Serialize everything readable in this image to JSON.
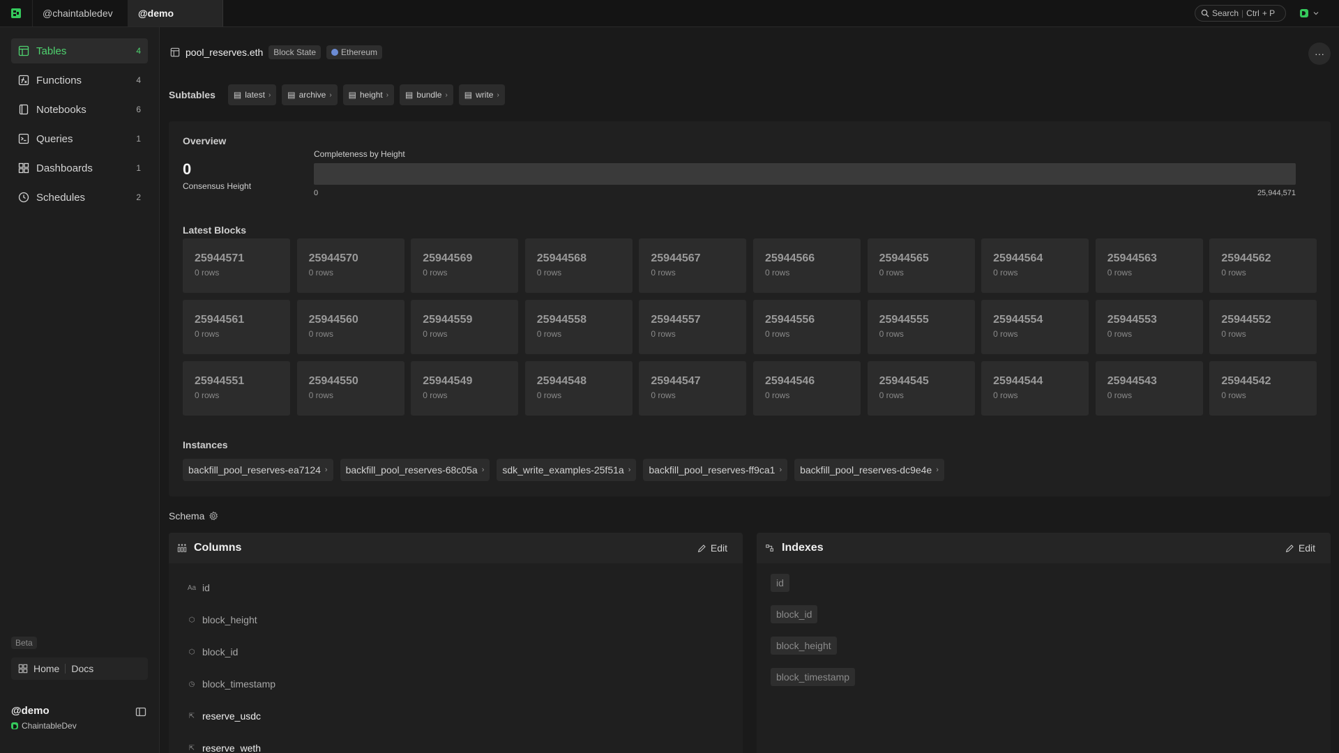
{
  "topbar": {
    "tabs": [
      {
        "label": "@chaintabledev",
        "active": false
      },
      {
        "label": "@demo",
        "active": true
      }
    ],
    "search": {
      "label": "Search",
      "key1": "Ctrl",
      "key2": "+ P"
    }
  },
  "sidebar": {
    "items": [
      {
        "label": "Tables",
        "count": "4",
        "icon": "table-icon",
        "active": true
      },
      {
        "label": "Functions",
        "count": "4",
        "icon": "function-icon",
        "active": false
      },
      {
        "label": "Notebooks",
        "count": "6",
        "icon": "notebook-icon",
        "active": false
      },
      {
        "label": "Queries",
        "count": "1",
        "icon": "terminal-icon",
        "active": false
      },
      {
        "label": "Dashboards",
        "count": "1",
        "icon": "grid-icon",
        "active": false
      },
      {
        "label": "Schedules",
        "count": "2",
        "icon": "clock-icon",
        "active": false
      }
    ],
    "beta": "Beta",
    "home_label": "Home",
    "docs_label": "Docs",
    "workspace": {
      "name": "@demo",
      "org": "ChaintableDev"
    }
  },
  "table": {
    "name": "pool_reserves.eth",
    "tag_block_state": "Block State",
    "tag_chain": "Ethereum"
  },
  "subtables": {
    "label": "Subtables",
    "items": [
      "latest",
      "archive",
      "height",
      "bundle",
      "write"
    ]
  },
  "overview": {
    "title": "Overview",
    "consensus_value": "0",
    "consensus_label": "Consensus Height",
    "completeness_label": "Completeness by Height",
    "completeness_fraction": 0,
    "range_min": "0",
    "range_max": "25,944,571"
  },
  "latest_blocks": {
    "title": "Latest Blocks",
    "blocks": [
      {
        "number": "25944571",
        "rows": "0 rows"
      },
      {
        "number": "25944570",
        "rows": "0 rows"
      },
      {
        "number": "25944569",
        "rows": "0 rows"
      },
      {
        "number": "25944568",
        "rows": "0 rows"
      },
      {
        "number": "25944567",
        "rows": "0 rows"
      },
      {
        "number": "25944566",
        "rows": "0 rows"
      },
      {
        "number": "25944565",
        "rows": "0 rows"
      },
      {
        "number": "25944564",
        "rows": "0 rows"
      },
      {
        "number": "25944563",
        "rows": "0 rows"
      },
      {
        "number": "25944562",
        "rows": "0 rows"
      },
      {
        "number": "25944561",
        "rows": "0 rows"
      },
      {
        "number": "25944560",
        "rows": "0 rows"
      },
      {
        "number": "25944559",
        "rows": "0 rows"
      },
      {
        "number": "25944558",
        "rows": "0 rows"
      },
      {
        "number": "25944557",
        "rows": "0 rows"
      },
      {
        "number": "25944556",
        "rows": "0 rows"
      },
      {
        "number": "25944555",
        "rows": "0 rows"
      },
      {
        "number": "25944554",
        "rows": "0 rows"
      },
      {
        "number": "25944553",
        "rows": "0 rows"
      },
      {
        "number": "25944552",
        "rows": "0 rows"
      },
      {
        "number": "25944551",
        "rows": "0 rows"
      },
      {
        "number": "25944550",
        "rows": "0 rows"
      },
      {
        "number": "25944549",
        "rows": "0 rows"
      },
      {
        "number": "25944548",
        "rows": "0 rows"
      },
      {
        "number": "25944547",
        "rows": "0 rows"
      },
      {
        "number": "25944546",
        "rows": "0 rows"
      },
      {
        "number": "25944545",
        "rows": "0 rows"
      },
      {
        "number": "25944544",
        "rows": "0 rows"
      },
      {
        "number": "25944543",
        "rows": "0 rows"
      },
      {
        "number": "25944542",
        "rows": "0 rows"
      }
    ]
  },
  "instances": {
    "title": "Instances",
    "items": [
      "backfill_pool_reserves-ea7124",
      "backfill_pool_reserves-68c05a",
      "sdk_write_examples-25f51a",
      "backfill_pool_reserves-ff9ca1",
      "backfill_pool_reserves-dc9e4e"
    ]
  },
  "schema": {
    "title": "Schema",
    "columns": {
      "title": "Columns",
      "edit_label": "Edit",
      "items": [
        {
          "name": "id",
          "type_icon": "text-type-icon",
          "type_glyph": "Aa",
          "emphasis": false
        },
        {
          "name": "block_height",
          "type_icon": "number-type-icon",
          "type_glyph": "⬡",
          "emphasis": false
        },
        {
          "name": "block_id",
          "type_icon": "number-type-icon",
          "type_glyph": "⬡",
          "emphasis": false
        },
        {
          "name": "block_timestamp",
          "type_icon": "clock-type-icon",
          "type_glyph": "◷",
          "emphasis": false
        },
        {
          "name": "reserve_usdc",
          "type_icon": "decimal-type-icon",
          "type_glyph": "⇱",
          "emphasis": true
        },
        {
          "name": "reserve_weth",
          "type_icon": "decimal-type-icon",
          "type_glyph": "⇱",
          "emphasis": true
        }
      ]
    },
    "indexes": {
      "title": "Indexes",
      "edit_label": "Edit",
      "items": [
        "id",
        "block_id",
        "block_height",
        "block_timestamp"
      ]
    }
  }
}
